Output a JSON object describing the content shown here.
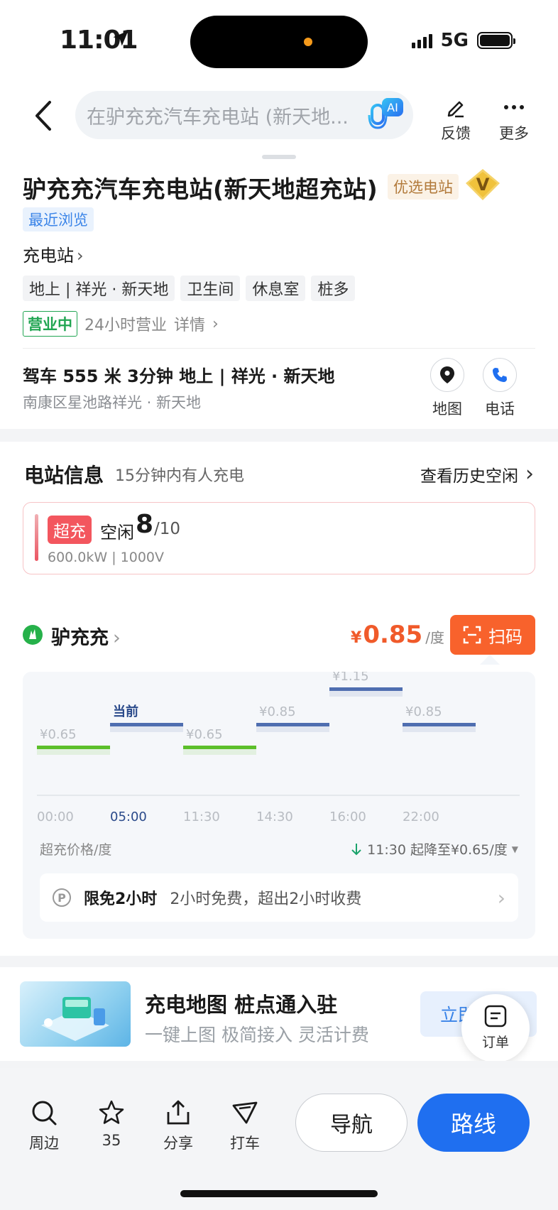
{
  "status": {
    "time": "11:01",
    "network": "5G"
  },
  "header": {
    "search_placeholder": "在驴充充汽车充电站 (新天地...",
    "ai_badge": "AI",
    "feedback": "反馈",
    "more": "更多"
  },
  "station": {
    "name": "驴充充汽车充电站(新天地超充站)",
    "preferred_tag": "优选电站",
    "vip_badge": "V",
    "recent_tag": "最近浏览",
    "category": "充电站",
    "tags": [
      "地上 | 祥光 · 新天地",
      "卫生间",
      "休息室",
      "桩多"
    ],
    "open_status": "营业中",
    "hours": "24小时营业",
    "details": "详情",
    "drive": "驾车 555 米 3分钟 地上 | 祥光 · 新天地",
    "address": "南康区星池路祥光 · 新天地",
    "map_label": "地图",
    "phone_label": "电话"
  },
  "info": {
    "title": "电站信息",
    "subtitle": "15分钟内有人充电",
    "history": "查看历史空闲",
    "charger": {
      "type": "超充",
      "free_label": "空闲",
      "free": "8",
      "total": "/10",
      "spec": "600.0kW | 1000V"
    }
  },
  "operator": {
    "name": "驴充充",
    "price_symbol": "¥",
    "price": "0.85",
    "price_unit": "/度",
    "scan": "扫码"
  },
  "price_chart": {
    "current_label": "当前",
    "segments": [
      {
        "price": "¥0.65",
        "tier": "low"
      },
      {
        "price": "",
        "tier": "mid",
        "current": true
      },
      {
        "price": "¥0.65",
        "tier": "low"
      },
      {
        "price": "¥0.85",
        "tier": "mid"
      },
      {
        "price": "¥1.15",
        "tier": "high"
      },
      {
        "price": "¥0.85",
        "tier": "mid"
      }
    ],
    "times": [
      "00:00",
      "05:00",
      "11:30",
      "14:30",
      "16:00",
      "22:00"
    ],
    "colors": {
      "low": "#5cbf2a",
      "mid": "#4f6eb0"
    },
    "footer_label": "超充价格/度",
    "drop_note": "11:30 起降至¥0.65/度"
  },
  "parking": {
    "icon": "P",
    "title": "限免2小时",
    "desc": "2小时免费，超出2小时收费"
  },
  "promo": {
    "title": "充电地图  桩点通入驻",
    "subtitle": "一键上图 极简接入 灵活计费",
    "button": "立即",
    "order": "订单"
  },
  "bottom": {
    "nearby": "周边",
    "favorites": "35",
    "share": "分享",
    "taxi": "打车",
    "navigate": "导航",
    "route": "路线"
  }
}
